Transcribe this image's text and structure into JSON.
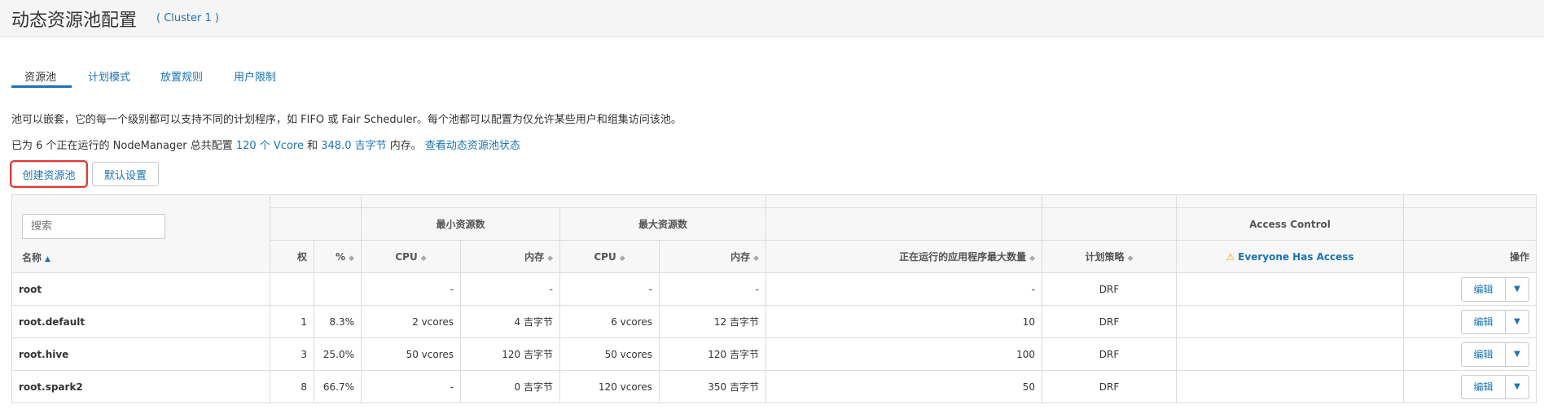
{
  "page": {
    "title": "动态资源池配置",
    "cluster": "( Cluster 1 )"
  },
  "tabs": [
    {
      "label": "资源池",
      "active": true
    },
    {
      "label": "计划模式"
    },
    {
      "label": "放置规则"
    },
    {
      "label": "用户限制"
    }
  ],
  "info": {
    "line1": "池可以嵌套，它的每一个级别都可以支持不同的计划程序，如 FIFO 或 Fair Scheduler。每个池都可以配置为仅允许某些用户和组集访问该池。",
    "line2_prefix": "已为 6 个正在运行的 NodeManager 总共配置 ",
    "vcore_link": "120 个 Vcore",
    "and": " 和 ",
    "memory_link": "348.0 吉字节",
    "memory_suffix": " 内存。 ",
    "status_link": "查看动态资源池状态"
  },
  "buttons": {
    "create": "创建资源池",
    "defaults": "默认设置"
  },
  "search": {
    "placeholder": "搜索"
  },
  "table": {
    "group_min": "最小资源数",
    "group_max": "最大资源数",
    "group_access": "Access Control",
    "col_name": "名称",
    "col_weight": "权",
    "col_pct": "%",
    "col_min_cpu": "CPU",
    "col_min_mem": "内存",
    "col_max_cpu": "CPU",
    "col_max_mem": "内存",
    "col_max_apps": "正在运行的应用程序最大数量",
    "col_policy": "计划策略",
    "col_access": "Everyone Has Access",
    "col_ops": "操作",
    "edit_label": "编辑",
    "rows": [
      {
        "name": "root",
        "weight": "",
        "pct": "",
        "min_cpu": "-",
        "min_mem": "-",
        "max_cpu": "-",
        "max_mem": "-",
        "max_apps": "-",
        "policy": "DRF"
      },
      {
        "name": "root.default",
        "weight": "1",
        "pct": "8.3%",
        "min_cpu": "2 vcores",
        "min_mem": "4 吉字节",
        "max_cpu": "6 vcores",
        "max_mem": "12 吉字节",
        "max_apps": "10",
        "policy": "DRF"
      },
      {
        "name": "root.hive",
        "weight": "3",
        "pct": "25.0%",
        "min_cpu": "50 vcores",
        "min_mem": "120 吉字节",
        "max_cpu": "50 vcores",
        "max_mem": "120 吉字节",
        "max_apps": "100",
        "policy": "DRF"
      },
      {
        "name": "root.spark2",
        "weight": "8",
        "pct": "66.7%",
        "min_cpu": "-",
        "min_mem": "0 吉字节",
        "max_cpu": "120 vcores",
        "max_mem": "350 吉字节",
        "max_apps": "50",
        "policy": "DRF"
      }
    ]
  },
  "colors": {
    "accent": "#1a73b5",
    "warning": "#f0a30a",
    "highlight": "#e53935"
  }
}
